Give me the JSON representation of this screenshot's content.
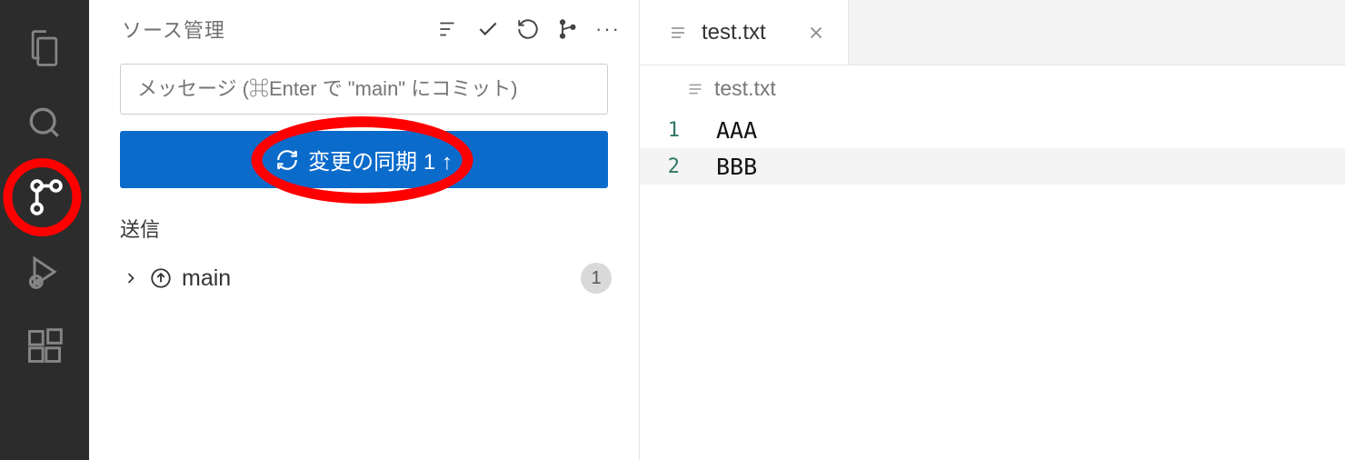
{
  "sidebar": {
    "title": "ソース管理",
    "commit_placeholder": "メッセージ (⌘Enter で \"main\" にコミット)",
    "sync_button_label": "変更の同期 1 ↑",
    "outgoing_section_label": "送信",
    "branches": [
      {
        "name": "main",
        "count": "1"
      }
    ]
  },
  "editor": {
    "tab": {
      "label": "test.txt"
    },
    "breadcrumb": "test.txt",
    "lines": [
      {
        "num": "1",
        "text": "AAA"
      },
      {
        "num": "2",
        "text": "BBB"
      }
    ]
  }
}
